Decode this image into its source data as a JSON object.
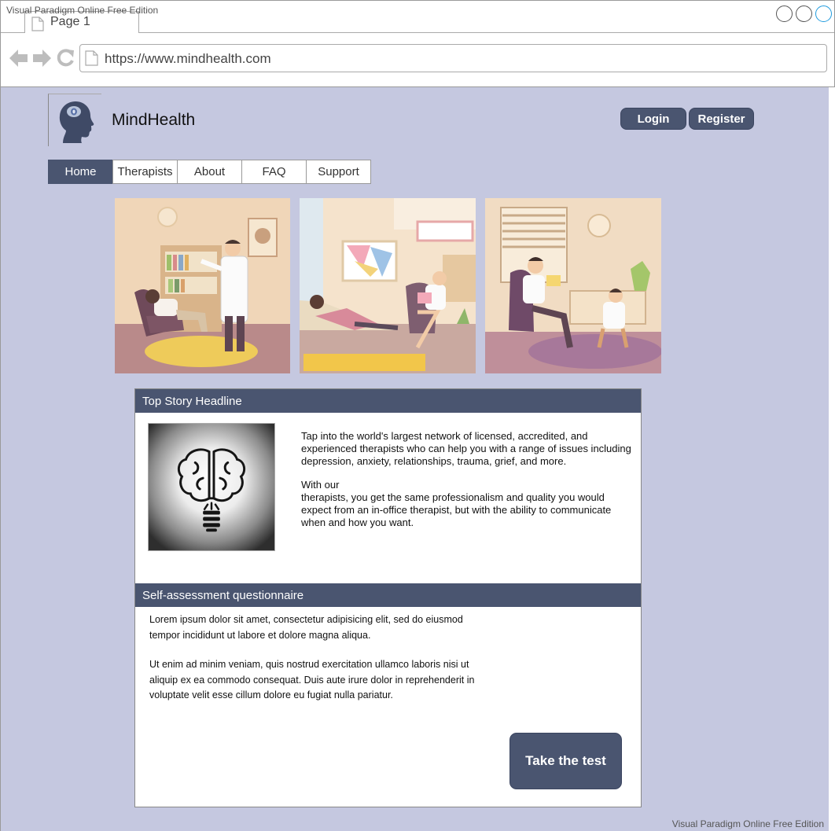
{
  "watermark": "Visual Paradigm Online Free Edition",
  "browser": {
    "tab_label": "Page 1",
    "url": "https://www.mindhealth.com"
  },
  "header": {
    "brand": "MindHealth",
    "login_label": "Login",
    "register_label": "Register"
  },
  "nav": {
    "items": [
      "Home",
      "Therapists",
      "About",
      "FAQ",
      "Support"
    ],
    "active": "Home"
  },
  "top_story": {
    "heading": "Top Story Headline",
    "paragraph1": "Tap into the world's largest network of licensed, accredited, and experienced therapists who can help you with a range of issues including depression, anxiety, relationships, trauma, grief, and more.",
    "paragraph2_line1": "With our",
    "paragraph2_rest": "therapists, you get the same professionalism and quality you would expect from an in-office therapist, but with the ability to communicate when and how you want."
  },
  "self_assessment": {
    "heading": "Self-assessment questionnaire",
    "paragraph1": "Lorem ipsum dolor sit amet, consectetur adipisicing elit, sed do eiusmod tempor incididunt ut labore et dolore magna aliqua.",
    "paragraph2": "Ut enim ad minim veniam, quis nostrud exercitation ullamco laboris nisi ut aliquip ex ea commodo consequat. Duis aute irure dolor in reprehenderit in voluptate velit esse cillum dolore eu fugiat nulla pariatur.",
    "cta_label": "Take the test"
  },
  "colors": {
    "page_bg": "#c5c8e0",
    "accent": "#4a5570"
  }
}
